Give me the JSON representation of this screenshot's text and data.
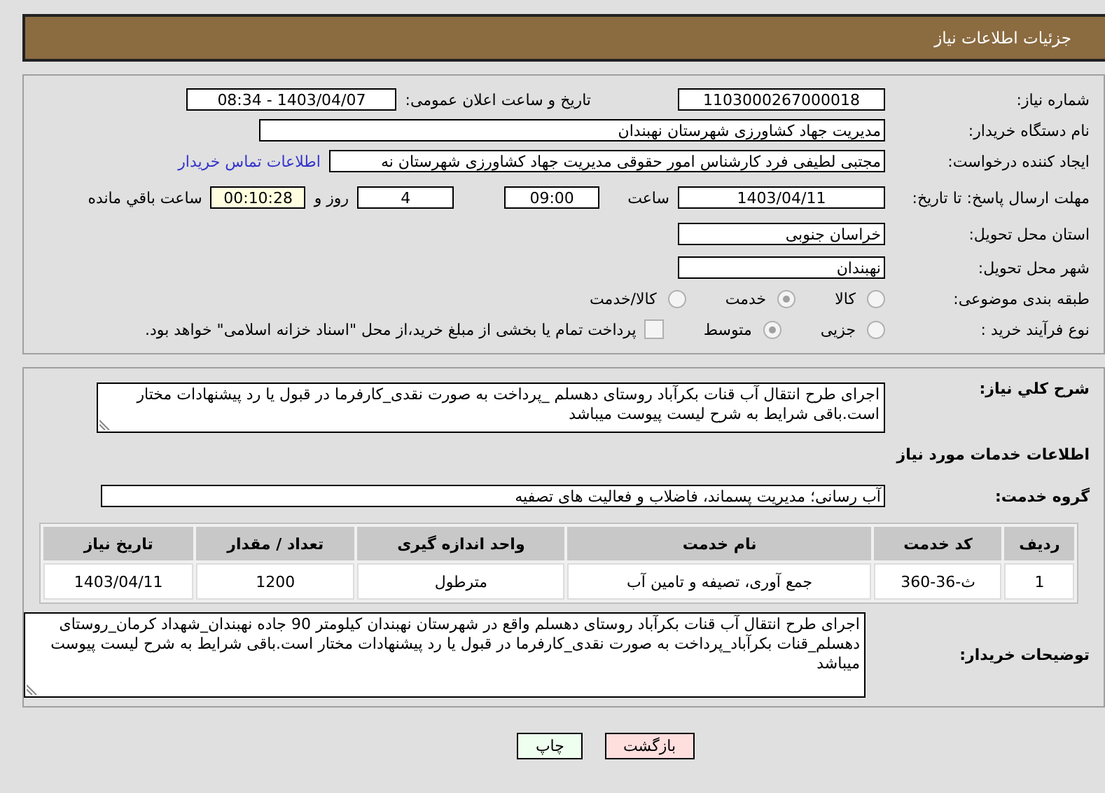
{
  "header": {
    "title": "جزئیات اطلاعات نیاز"
  },
  "need": {
    "number_label": "شماره نیاز:",
    "number": "1103000267000018",
    "announce_label": "تاریخ و ساعت اعلان عمومی:",
    "announce": "1403/04/07 - 08:34",
    "buyer_label": "نام دستگاه خریدار:",
    "buyer": "مدیریت جهاد کشاورزی شهرستان نهبندان",
    "creator_label": "ایجاد کننده درخواست:",
    "creator": "مجتبی لطیفی فرد کارشناس امور حقوقی مدیریت جهاد کشاورزی شهرستان نه",
    "contact_link": "اطلاعات تماس خریدار",
    "deadline_label": "مهلت ارسال پاسخ: تا تاریخ:",
    "deadline_date": "1403/04/11",
    "time_label": "ساعت",
    "deadline_time": "09:00",
    "days": "4",
    "days_label": "روز و",
    "remaining": "00:10:28",
    "remaining_label": "ساعت باقي مانده",
    "province_label": "استان محل تحویل:",
    "province": "خراسان جنوبی",
    "city_label": "شهر محل تحویل:",
    "city": "نهبندان",
    "category_label": "طبقه بندی موضوعی:",
    "category": [
      {
        "label": "کالا",
        "selected": false
      },
      {
        "label": "خدمت",
        "selected": true
      },
      {
        "label": "کالا/خدمت",
        "selected": false
      }
    ],
    "process_label": "نوع فرآیند خرید :",
    "process": [
      {
        "label": "جزیی",
        "selected": false
      },
      {
        "label": "متوسط",
        "selected": true
      }
    ],
    "payment": {
      "checked": false,
      "label": "پرداخت تمام یا بخشی از مبلغ خرید،از محل \"اسناد خزانه اسلامی\" خواهد بود."
    }
  },
  "details": {
    "description_label": "شرح کلي نیاز:",
    "description": "اجرای طرح انتقال آب قنات بکرآباد روستای دهسلم _پرداخت به صورت نقدی_کارفرما در قبول یا رد پیشنهادات مختار است.باقی شرایط به شرح لیست پیوست میباشد",
    "services_heading": "اطلاعات خدمات مورد نیاز",
    "group_label": "گروه خدمت:",
    "group": "آب رسانی؛ مدیریت پسماند، فاضلاب و فعالیت های تصفیه",
    "table": {
      "columns": [
        "ردیف",
        "کد خدمت",
        "نام خدمت",
        "واحد اندازه گیری",
        "تعداد / مقدار",
        "تاریخ نیاز"
      ],
      "rows": [
        [
          "1",
          "ث-36-360",
          "جمع آوری، تصیفه و تامین آب",
          "مترطول",
          "1200",
          "1403/04/11"
        ]
      ]
    },
    "notes_label": "توضیحات خریدار:",
    "notes": "اجرای طرح انتقال آب قنات بکرآباد روستای دهسلم واقع در شهرستان نهبندان کیلومتر 90 جاده نهبندان_شهداد کرمان_روستای دهسلم_قنات بکرآباد_پرداخت به صورت نقدی_کارفرما در قبول یا رد پیشنهادات مختار است.باقی شرایط به شرح لیست پیوست میباشد"
  },
  "buttons": [
    {
      "label": "بازگشت",
      "kind": "back"
    },
    {
      "label": "چاپ",
      "kind": "print"
    }
  ]
}
